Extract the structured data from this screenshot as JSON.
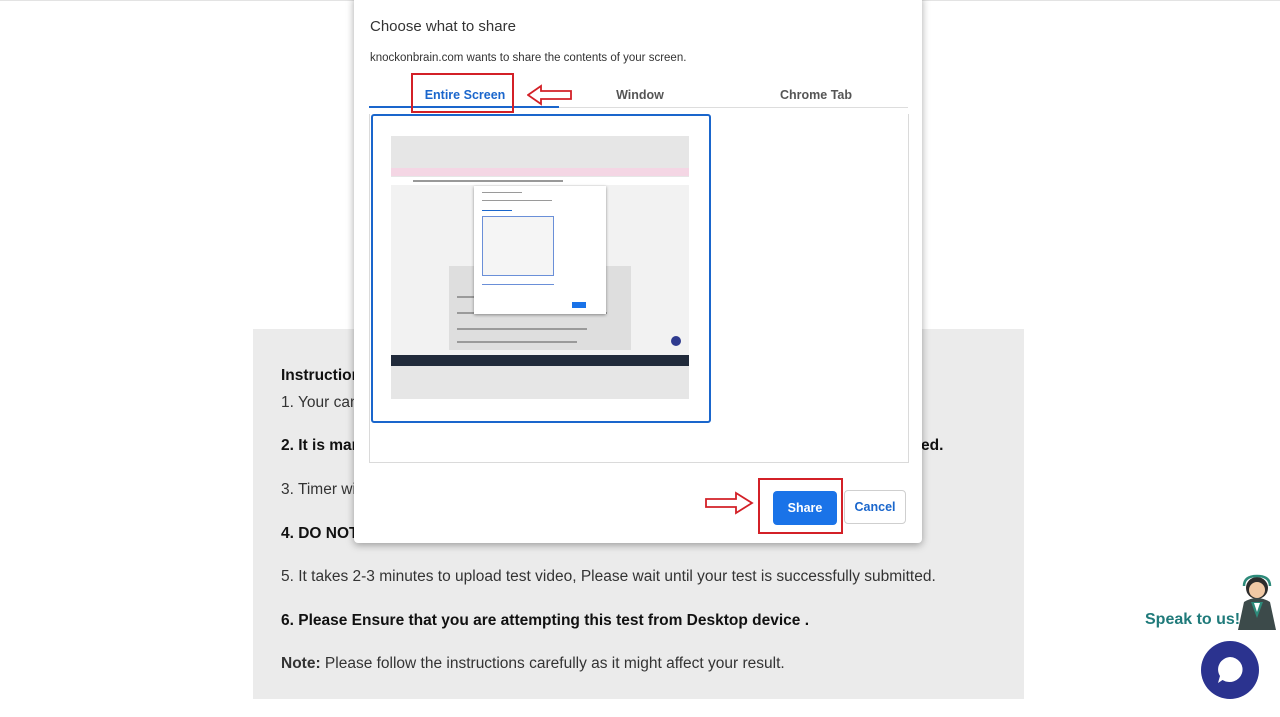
{
  "instructions": {
    "lines": [
      "Instruction",
      "1. Your cam",
      "2. It is mar",
      "ed.",
      "3. Timer wil",
      "4. DO NOT",
      "5. It takes 2-3 minutes to upload test video, Please wait until your test is successfully submitted.",
      "6. Please Ensure that you are attempting this test from Desktop device .",
      "Please follow the instructions carefully as it might affect your result."
    ],
    "note_label": "Note:"
  },
  "dialog": {
    "title": "Choose what to share",
    "subtitle": "knockonbrain.com wants to share the contents of your screen.",
    "tabs": [
      "Entire Screen",
      "Window",
      "Chrome Tab"
    ],
    "active_tab": "Entire Screen",
    "share_label": "Share",
    "cancel_label": "Cancel"
  },
  "widget": {
    "speak_label": "Speak to us!"
  },
  "colors": {
    "accent": "#1a73e8",
    "highlight": "#d32027",
    "chat": "#2b338f",
    "speak": "#1f7a7a"
  },
  "icons": [
    "arrow-left-icon",
    "arrow-right-icon",
    "agent-icon",
    "chat-bubble-icon"
  ]
}
